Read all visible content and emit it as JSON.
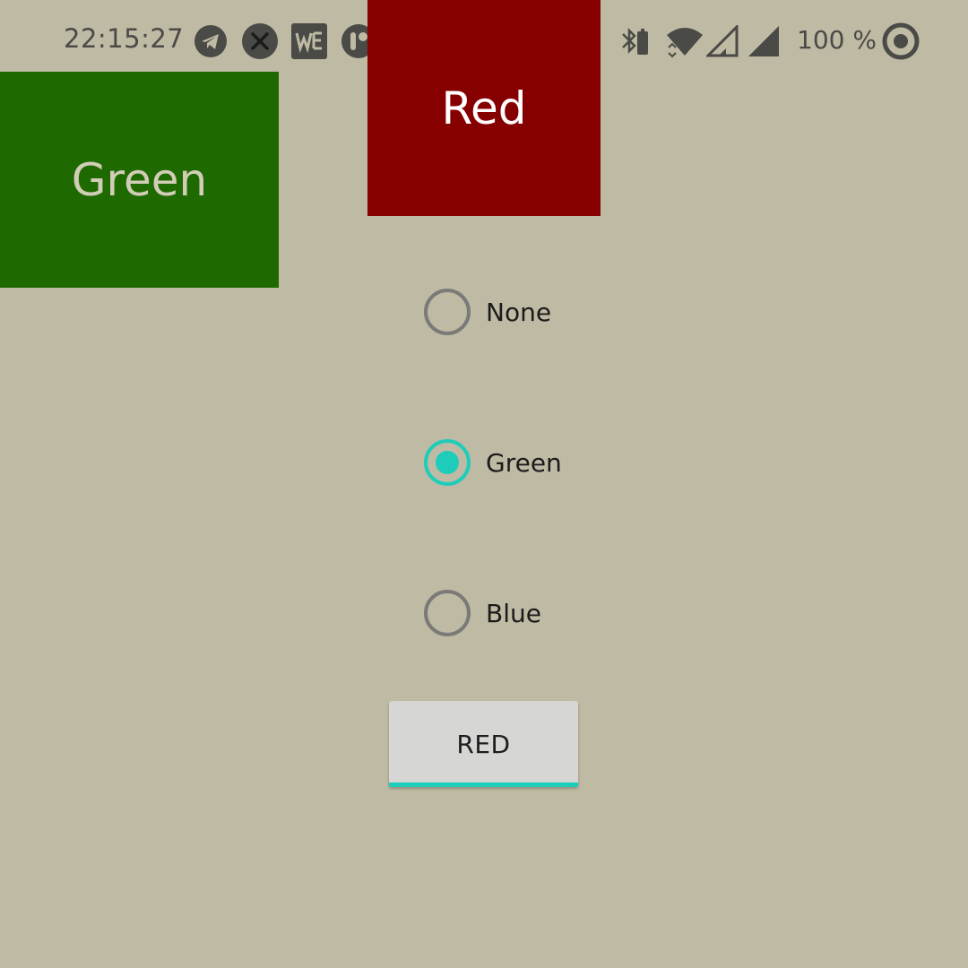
{
  "status_bar": {
    "time": "22:15:27",
    "battery": "100 %",
    "notification_icons": [
      "telegram-icon",
      "close-circle-icon",
      "app-w-icon",
      "app-round-icon"
    ],
    "system_icons": [
      "bluetooth-battery-icon",
      "wifi-icon",
      "signal-outline-icon",
      "signal-icon",
      "target-icon"
    ]
  },
  "boxes": {
    "green": {
      "label": "Green",
      "color": "#1f6a00"
    },
    "red": {
      "label": "Red",
      "color": "#870000"
    }
  },
  "radio_group": {
    "options": [
      {
        "label": "None",
        "checked": false
      },
      {
        "label": "Green",
        "checked": true
      },
      {
        "label": "Blue",
        "checked": false
      }
    ],
    "accent_color": "#1ecdb9"
  },
  "button": {
    "label": "RED"
  }
}
